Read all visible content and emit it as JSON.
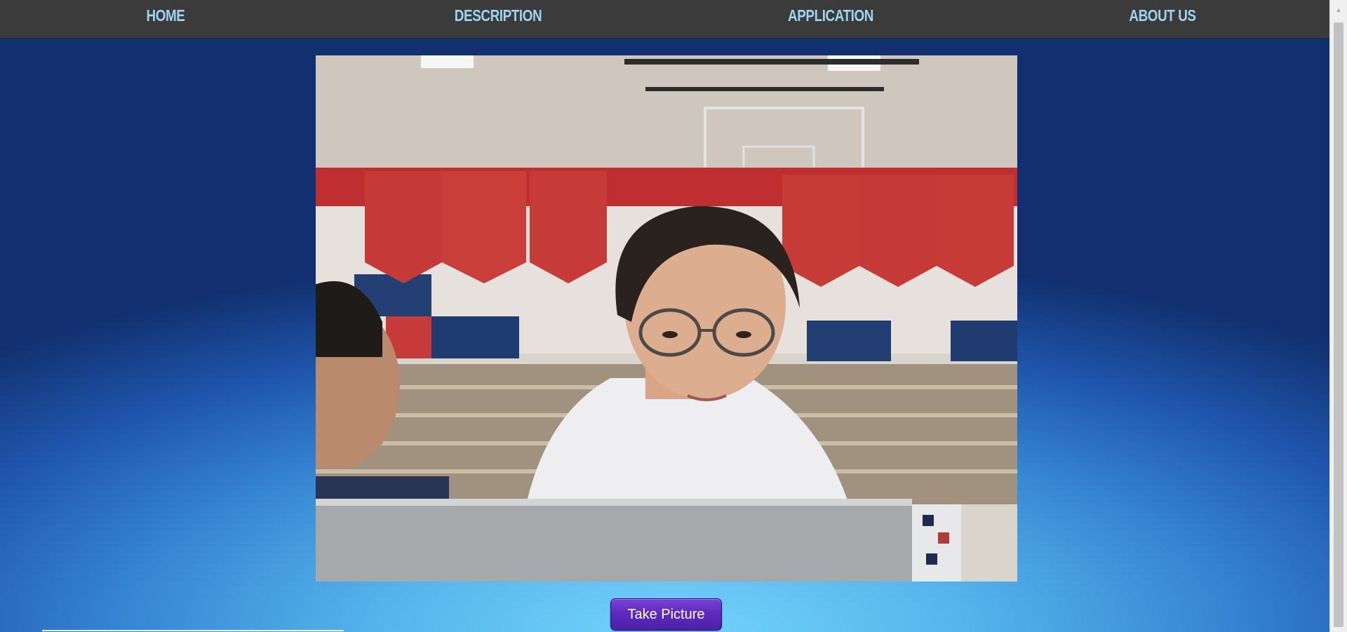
{
  "nav": {
    "items": [
      {
        "label": "HOME"
      },
      {
        "label": "DESCRIPTION"
      },
      {
        "label": "APPLICATION"
      },
      {
        "label": "ABOUT US"
      }
    ]
  },
  "webcam": {
    "icon": "camera-feed"
  },
  "actions": {
    "take_picture_label": "Take Picture"
  },
  "colors": {
    "nav_background": "#3b3b3b",
    "nav_link": "#9fd3ee",
    "background_top": "#12306f",
    "background_bottom": "#74d3fb",
    "button": "#5e2bbd"
  }
}
